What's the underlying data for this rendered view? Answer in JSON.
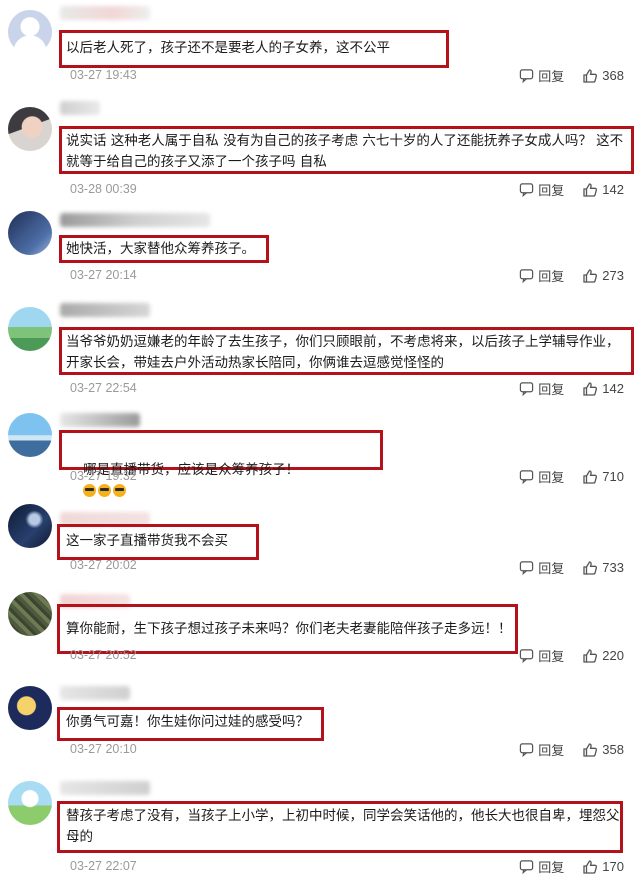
{
  "actions": {
    "reply_label": "回复",
    "reply_icon": "chat-bubble-icon",
    "like_icon": "thumbs-up-icon"
  },
  "comments": [
    {
      "text": "以后老人死了，孩子还不是要老人的子女养，这不公平",
      "time": "03-27 19:43",
      "likes": "368"
    },
    {
      "text": "说实话 这种老人属于自私 没有为自己的孩子考虑 六七十岁的人了还能抚养子女成人吗？ 这不就等于给自己的孩子又添了一个孩子吗 自私",
      "time": "03-28 00:39",
      "likes": "142"
    },
    {
      "text": "她快活，大家替他众筹养孩子。",
      "time": "03-27 20:14",
      "likes": "273"
    },
    {
      "text": "当爷爷奶奶逗嫌老的年龄了去生孩子，你们只顾眼前，不考虑将来，以后孩子上学辅导作业，开家长会，带娃去户外活动热家长陪同，你俩谁去逗感觉怪怪的",
      "time": "03-27 22:54",
      "likes": "142"
    },
    {
      "text": "哪是直播带货，应该是众筹养孩子！",
      "time": "03-27 19:32",
      "likes": "710"
    },
    {
      "text": "这一家子直播带货我不会买",
      "time": "03-27 20:02",
      "likes": "733"
    },
    {
      "text": "算你能耐，生下孩子想过孩子未来吗？你们老夫老妻能陪伴孩子走多远！！",
      "time": "03-27 20:52",
      "likes": "220"
    },
    {
      "text": "你勇气可嘉！你生娃你问过娃的感受吗？",
      "time": "03-27 20:10",
      "likes": "358"
    },
    {
      "text": "替孩子考虑了没有，当孩子上小学，上初中时候，同学会笑话他的，他长大也很自卑，埋怨父母的",
      "time": "03-27 22:07",
      "likes": "170"
    }
  ],
  "colors": {
    "highlight_box": "#b3121a",
    "timestamp": "#9a9a9a"
  }
}
